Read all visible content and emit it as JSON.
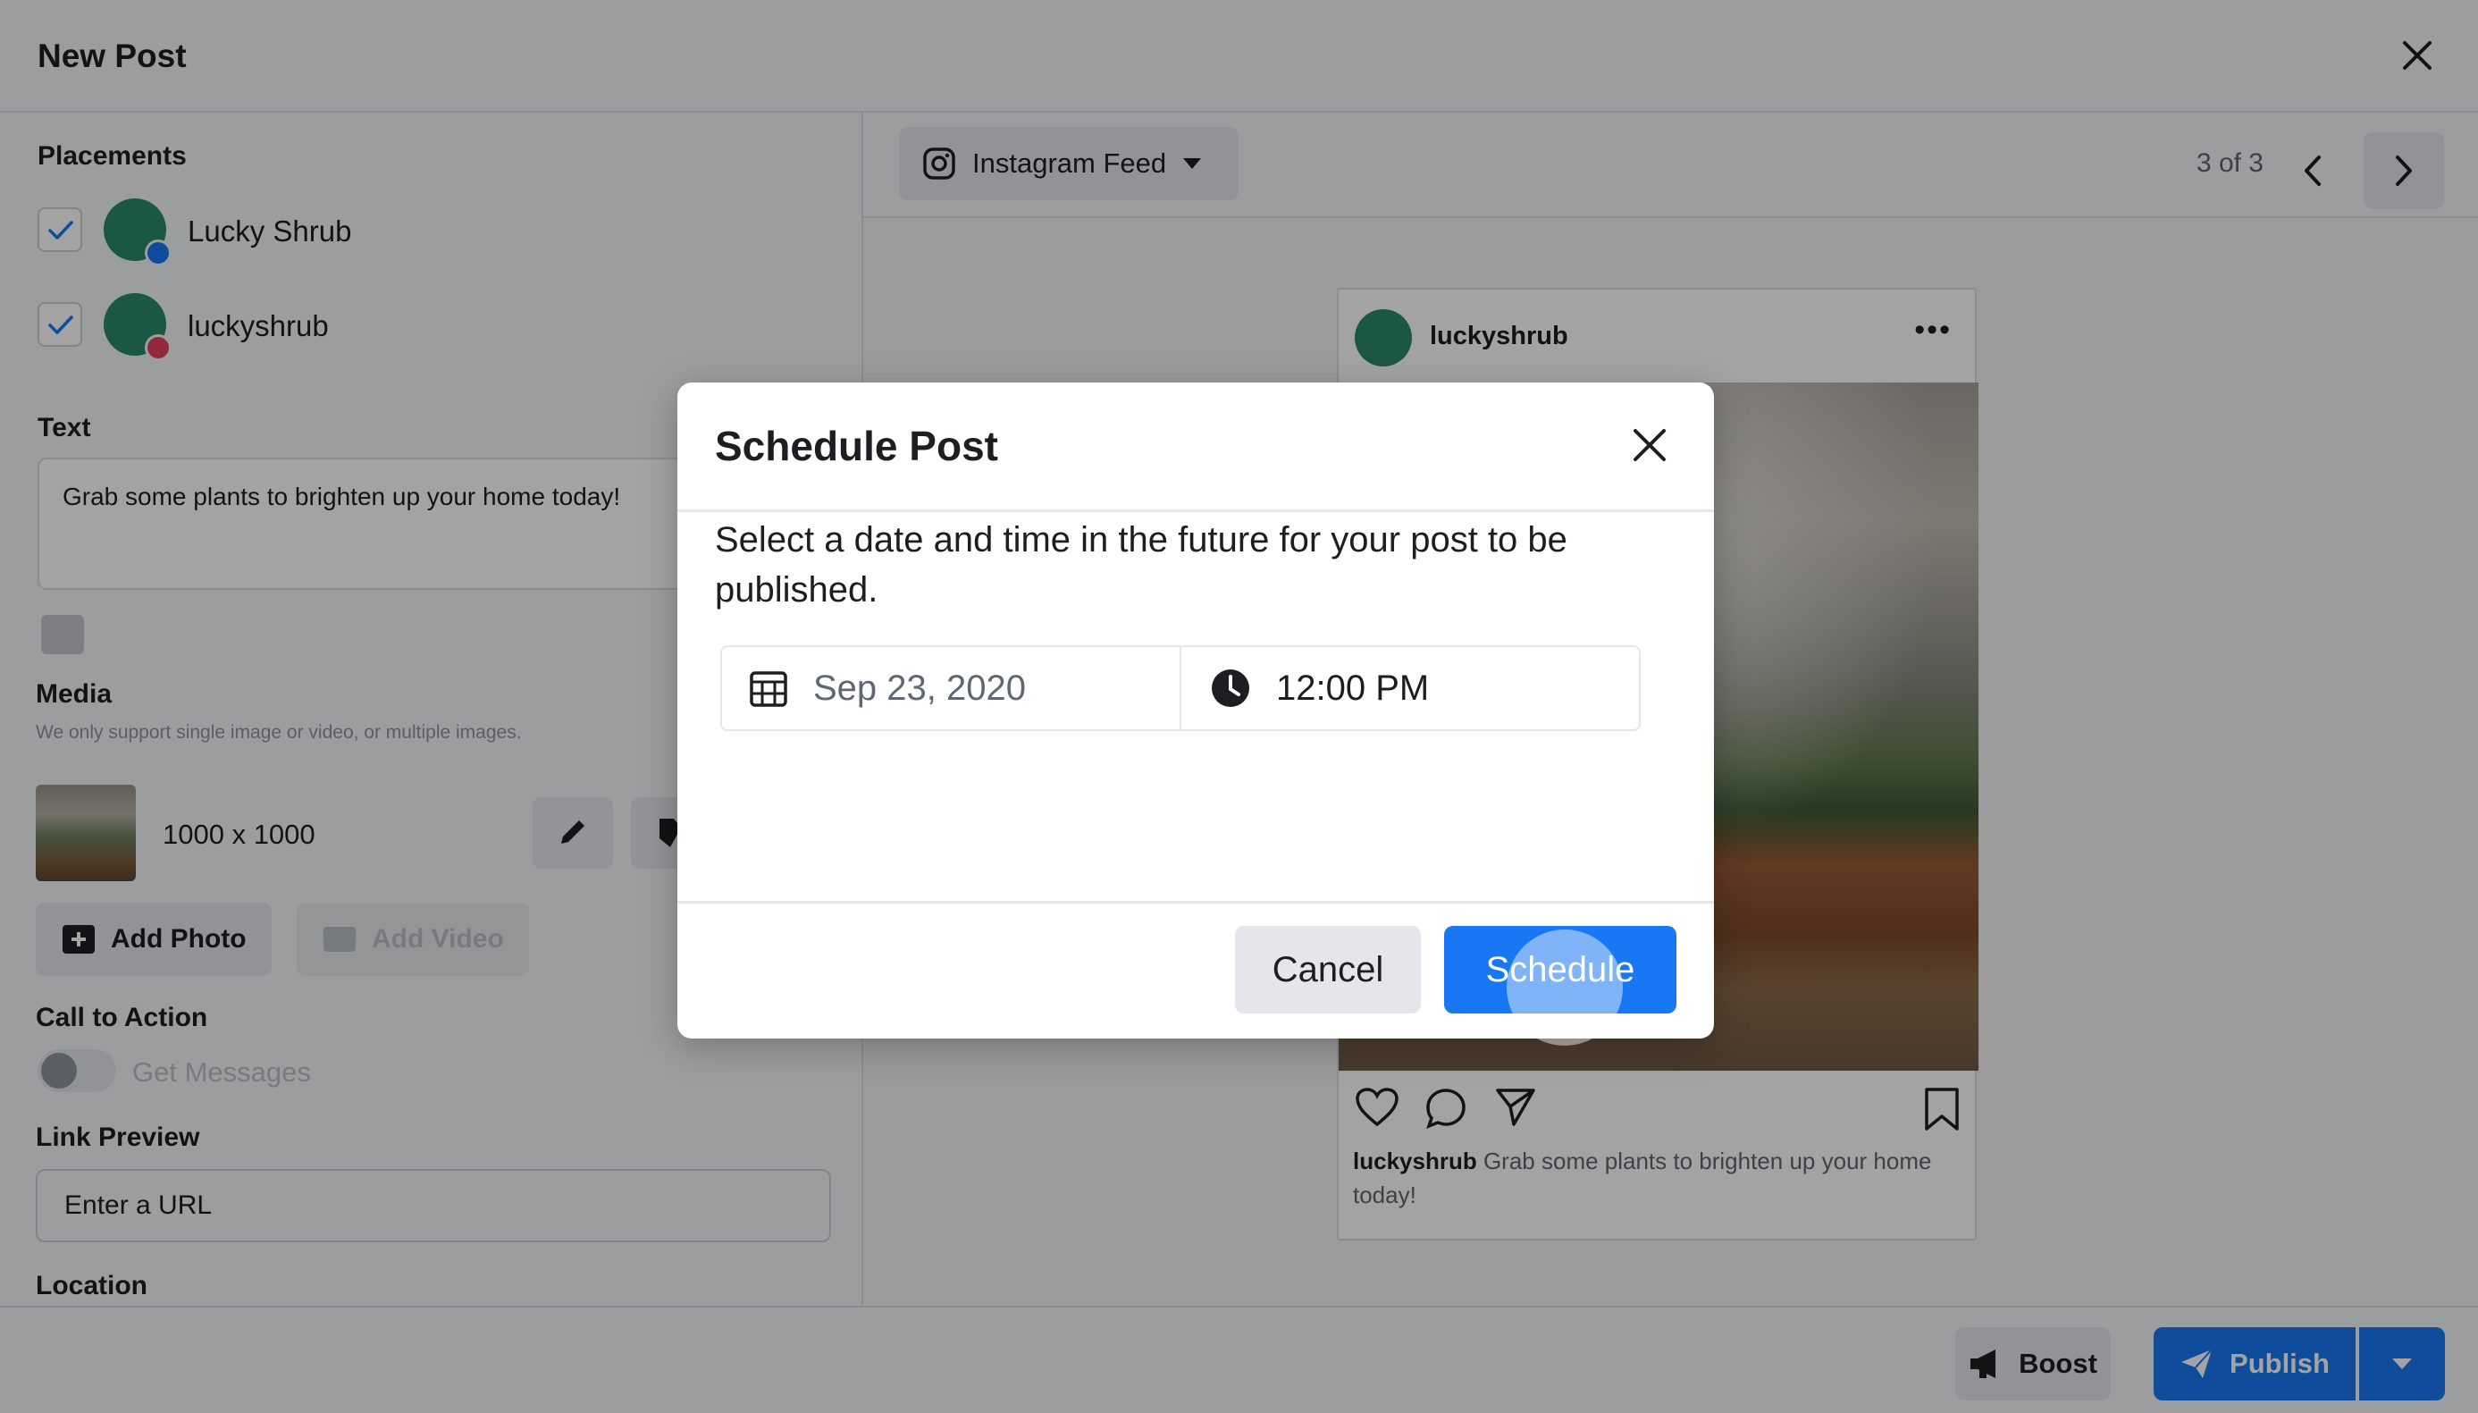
{
  "window": {
    "title": "New Post"
  },
  "placements": {
    "label": "Placements",
    "accounts": [
      {
        "name": "Lucky Shrub",
        "network": "facebook"
      },
      {
        "name": "luckyshrub",
        "network": "instagram"
      }
    ]
  },
  "text_section": {
    "label": "Text",
    "value": "Grab some plants to brighten up your home today!"
  },
  "media": {
    "label": "Media",
    "hint": "We only support single image or video, or multiple images.",
    "dimensions": "1000 x 1000",
    "add_photo": "Add Photo",
    "add_video": "Add Video"
  },
  "cta": {
    "label": "Call to Action",
    "toggle_label": "Get Messages",
    "enabled": false
  },
  "link_preview": {
    "label": "Link Preview",
    "value": "Enter a URL"
  },
  "location": {
    "label": "Location"
  },
  "preview": {
    "feed_label": "Instagram Feed",
    "pager": "3 of 3",
    "post": {
      "username": "luckyshrub",
      "caption_user": "luckyshrub",
      "caption_text": "Grab some plants to brighten up your home today!"
    }
  },
  "footer": {
    "boost": "Boost",
    "publish": "Publish"
  },
  "modal": {
    "title": "Schedule Post",
    "description": "Select a date and time in the future for your post to be published.",
    "date": "Sep 23, 2020",
    "time": "12:00 PM",
    "cancel": "Cancel",
    "schedule": "Schedule"
  },
  "colors": {
    "accent": "#1877f2",
    "avatar": "#2a8a6a",
    "facebook": "#1877f2",
    "instagram": "#e4405f"
  }
}
